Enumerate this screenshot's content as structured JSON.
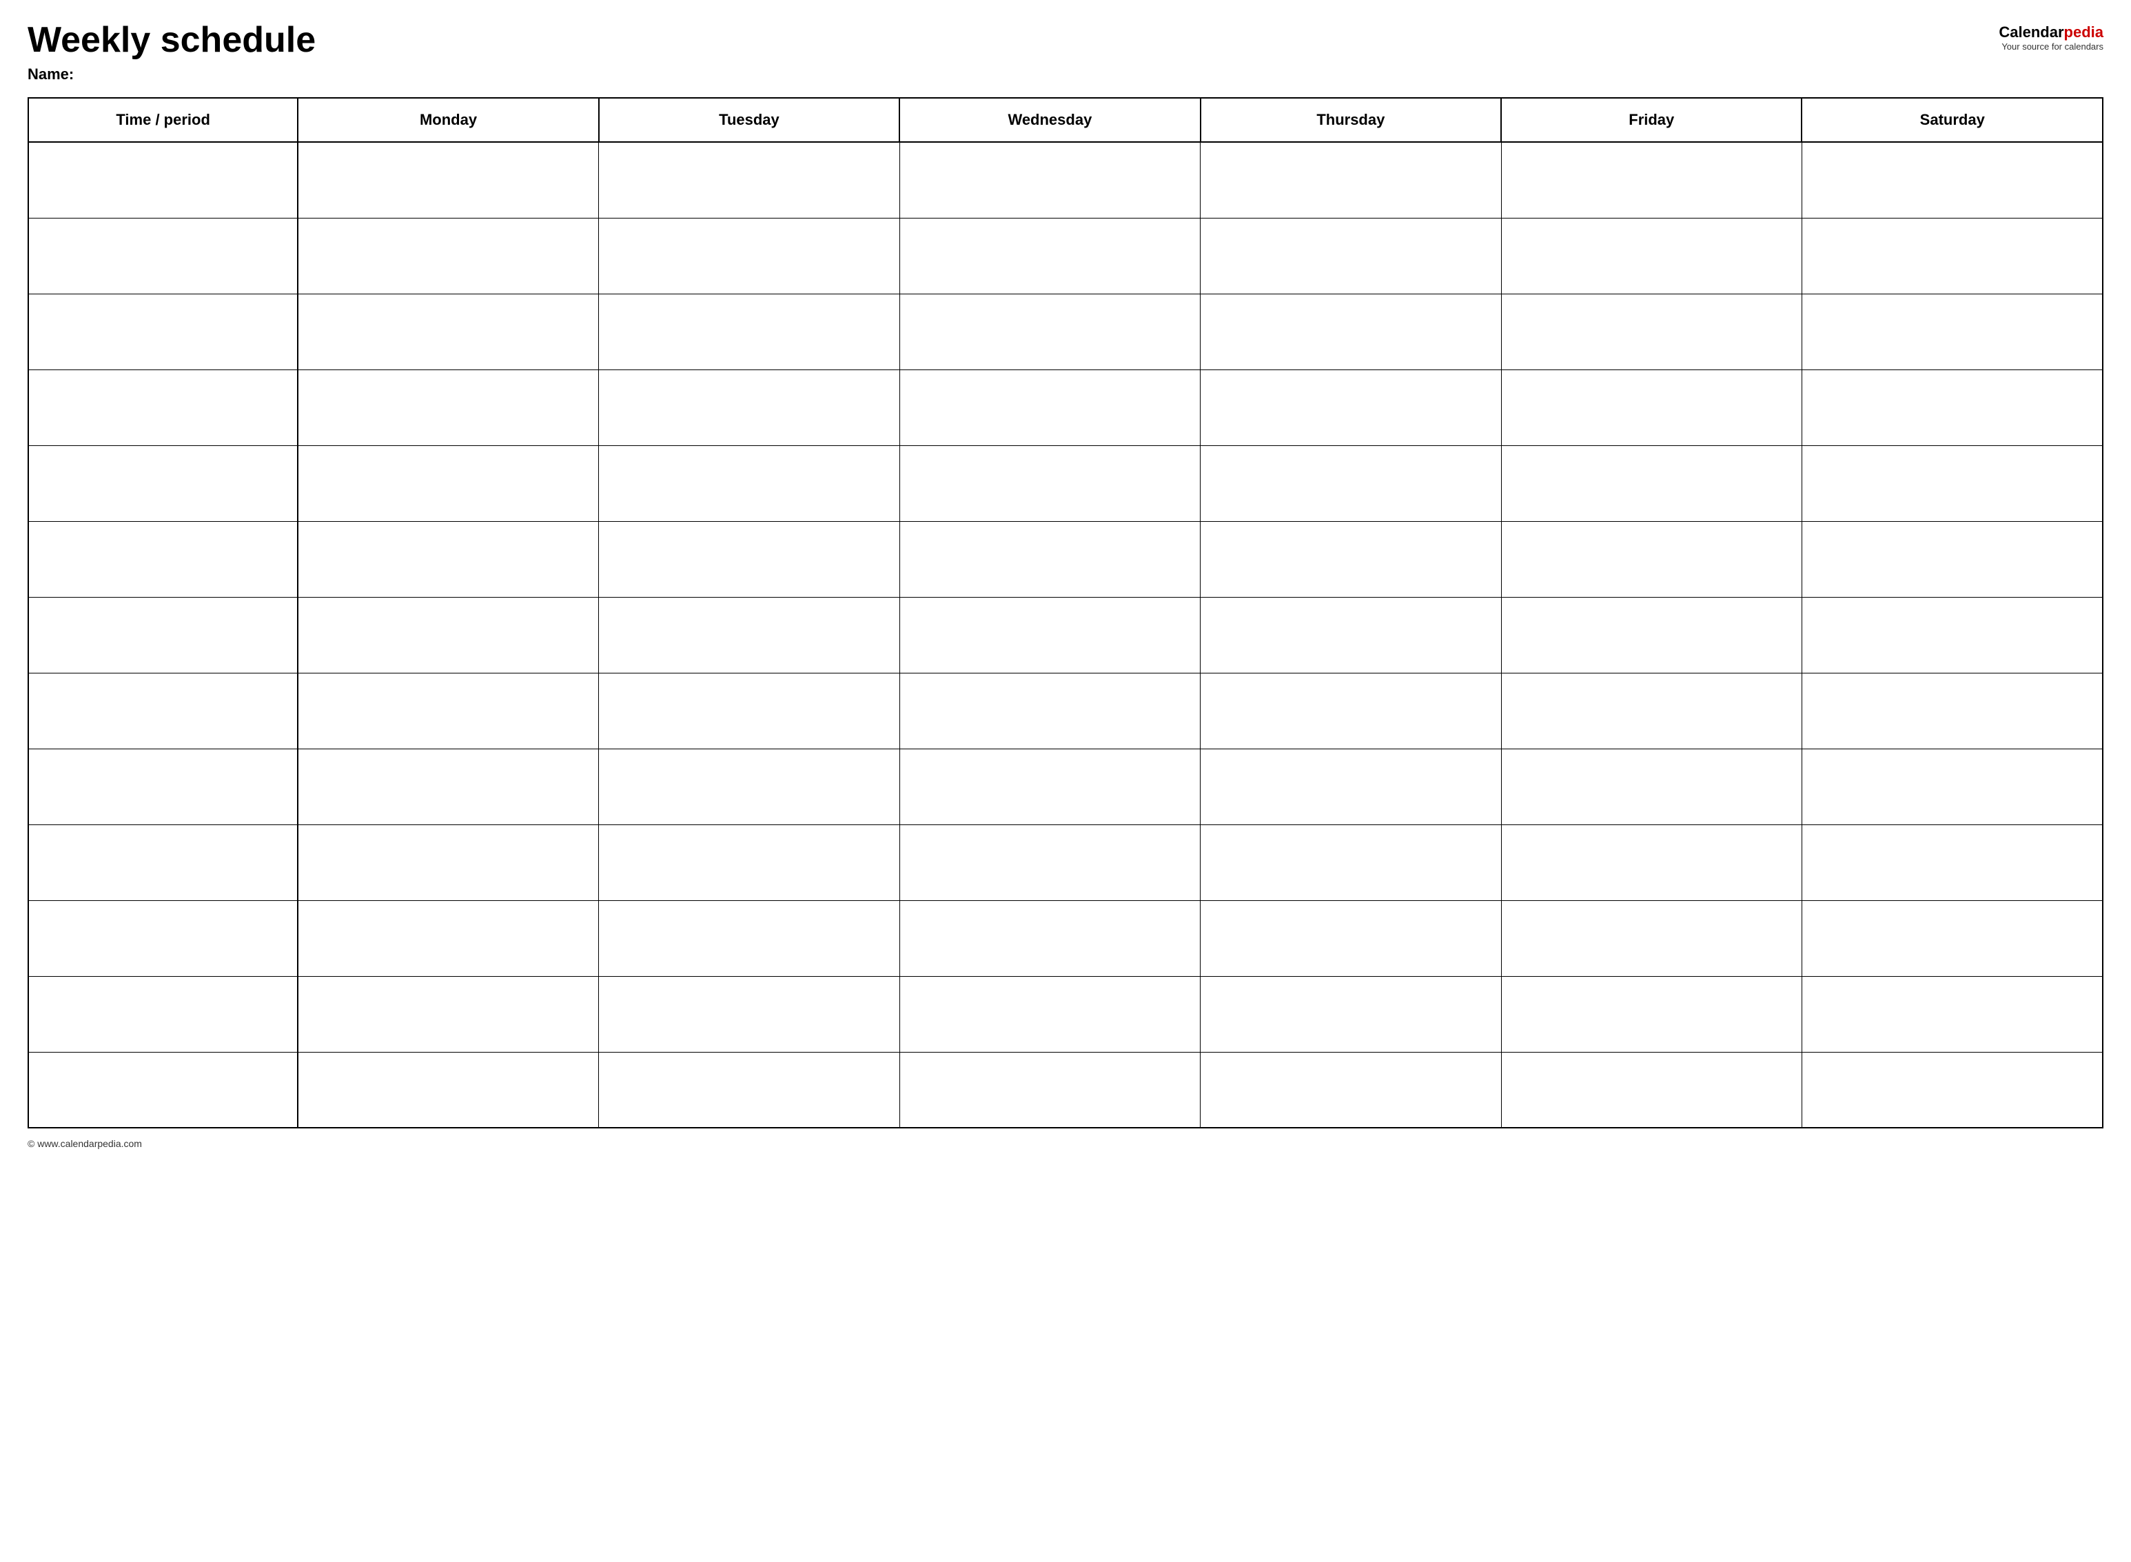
{
  "header": {
    "title": "Weekly schedule",
    "name_label": "Name:",
    "logo": {
      "text_black1": "Calendar",
      "text_red": "pedia",
      "subtitle": "Your source for calendars"
    }
  },
  "table": {
    "columns": [
      {
        "label": "Time / period",
        "key": "time"
      },
      {
        "label": "Monday",
        "key": "monday"
      },
      {
        "label": "Tuesday",
        "key": "tuesday"
      },
      {
        "label": "Wednesday",
        "key": "wednesday"
      },
      {
        "label": "Thursday",
        "key": "thursday"
      },
      {
        "label": "Friday",
        "key": "friday"
      },
      {
        "label": "Saturday",
        "key": "saturday"
      }
    ],
    "row_count": 13
  },
  "footer": {
    "text": "© www.calendarpedia.com"
  }
}
